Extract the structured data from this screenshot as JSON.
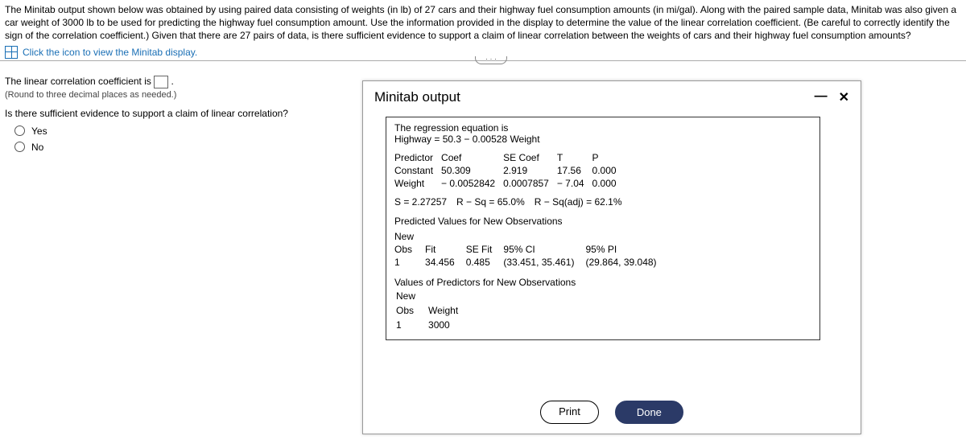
{
  "top": {
    "paragraph": "The Minitab output shown below was obtained by using paired data consisting of weights (in lb) of 27 cars and their highway fuel consumption amounts (in mi/gal). Along with the paired sample data, Minitab was also given a car weight of 3000 lb to be used for predicting the highway fuel consumption amount. Use the information provided in the display to determine the value of the linear correlation coefficient. (Be careful to correctly identify the sign of the correlation coefficient.) Given that there are 27 pairs of data, is there sufficient evidence to support a claim of linear correlation between the weights of cars and their highway fuel consumption amounts?",
    "click_text": "Click the icon to view the Minitab display."
  },
  "left": {
    "coef_label_pre": "The linear correlation coefficient is ",
    "coef_label_post": ".",
    "round_instr": "(Round to three decimal places as needed.)",
    "q2": "Is there sufficient evidence to support a claim of linear correlation?",
    "opt_yes": "Yes",
    "opt_no": "No"
  },
  "modal": {
    "title": "Minitab output",
    "minimize": "—",
    "close": "✕",
    "eq_label": "The regression equation is",
    "eq": "Highway = 50.3 − 0.00528 Weight",
    "tbl": {
      "h": [
        "Predictor",
        "Coef",
        "SE Coef",
        "T",
        "P"
      ],
      "r1": [
        "Constant",
        "50.309",
        "2.919",
        "17.56",
        "0.000"
      ],
      "r2": [
        "Weight",
        "− 0.0052842",
        "0.0007857",
        "− 7.04",
        "0.000"
      ]
    },
    "sline": "S = 2.27257 R − Sq = 65.0% R − Sq(adj) = 62.1%",
    "pred_title": "Predicted Values for New Observations",
    "new": {
      "h1": "New",
      "h2": [
        "Obs",
        "Fit",
        "SE Fit",
        "95% CI",
        "95% PI"
      ],
      "r": [
        "1",
        "34.456",
        "0.485",
        "(33.451, 35.461)",
        "(29.864, 39.048)"
      ]
    },
    "valpred_title": "Values of Predictors for New Observations",
    "predvals": {
      "h1": "New",
      "h2": [
        "Obs",
        "Weight"
      ],
      "r": [
        "1",
        "3000"
      ]
    },
    "print": "Print",
    "done": "Done"
  }
}
